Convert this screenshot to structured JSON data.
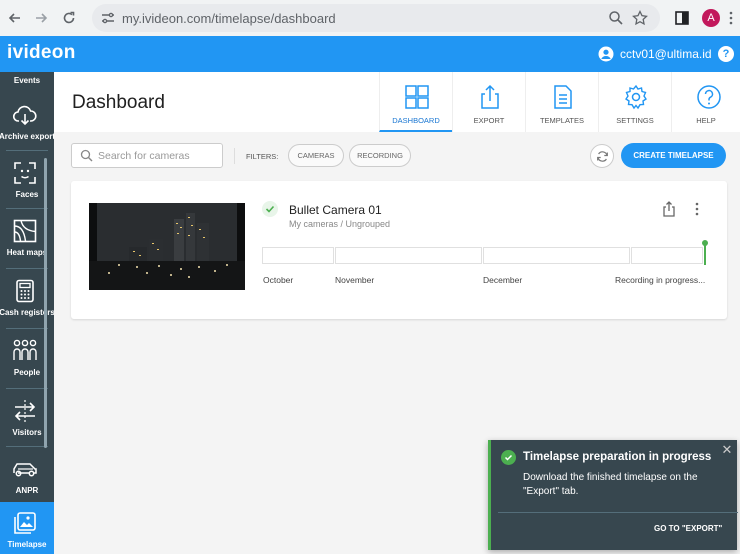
{
  "browser": {
    "url": "my.ivideon.com/timelapse/dashboard",
    "profile_initial": "A"
  },
  "app": {
    "logo": "ivideon",
    "user": "cctv01@ultima.id",
    "help_symbol": "?",
    "brand_color": "#2196f3"
  },
  "sidebar": {
    "partial_item": "Events",
    "items": [
      {
        "label": "Archive export",
        "icon": "cloud-download-icon"
      },
      {
        "label": "Faces",
        "icon": "face-scan-icon"
      },
      {
        "label": "Heat maps",
        "icon": "heat-map-icon"
      },
      {
        "label": "Cash registers",
        "icon": "cash-register-icon"
      },
      {
        "label": "People",
        "icon": "people-icon"
      },
      {
        "label": "Visitors",
        "icon": "visitors-arrows-icon"
      },
      {
        "label": "ANPR",
        "icon": "car-icon"
      },
      {
        "label": "Timelapse",
        "icon": "timelapse-icon",
        "active": true
      }
    ]
  },
  "header": {
    "title": "Dashboard",
    "tabs": [
      {
        "label": "DASHBOARD",
        "icon": "dashboard-icon",
        "active": true
      },
      {
        "label": "EXPORT",
        "icon": "export-icon"
      },
      {
        "label": "TEMPLATES",
        "icon": "templates-icon"
      },
      {
        "label": "SETTINGS",
        "icon": "gear-icon"
      },
      {
        "label": "HELP",
        "icon": "help-icon"
      }
    ]
  },
  "filters": {
    "search_placeholder": "Search for cameras",
    "label": "FILTERS:",
    "chips": [
      "CAMERAS",
      "RECORDING"
    ],
    "create_button": "CREATE TIMELAPSE"
  },
  "camera": {
    "name": "Bullet Camera 01",
    "path": "My cameras / Ungrouped",
    "timeline_labels": [
      "October",
      "November",
      "December",
      "Recording in progress..."
    ],
    "status_color": "#4caf50"
  },
  "toast": {
    "title": "Timelapse preparation in progress",
    "message": "Download the finished timelapse on the \"Export\" tab.",
    "action": "GO TO \"EXPORT\"",
    "close_symbol": "✕"
  }
}
